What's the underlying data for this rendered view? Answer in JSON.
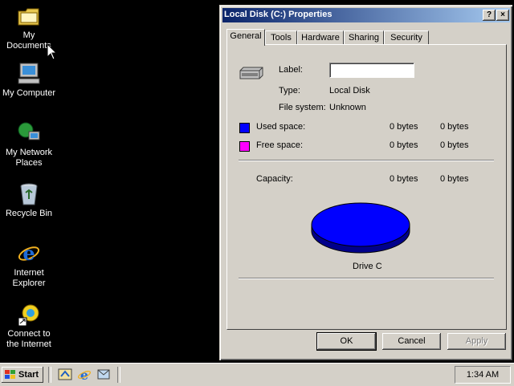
{
  "desktop": {
    "icons": [
      {
        "label_line1": "My Documents",
        "label_line2": ""
      },
      {
        "label_line1": "My Computer",
        "label_line2": ""
      },
      {
        "label_line1": "My Network",
        "label_line2": "Places"
      },
      {
        "label_line1": "Recycle Bin",
        "label_line2": ""
      },
      {
        "label_line1": "Internet",
        "label_line2": "Explorer"
      },
      {
        "label_line1": "Connect to",
        "label_line2": "the Internet"
      }
    ]
  },
  "window": {
    "title": "Local Disk (C:) Properties",
    "help_button": "?",
    "close_button": "×",
    "tabs": [
      "General",
      "Tools",
      "Hardware",
      "Sharing",
      "Security"
    ],
    "active_tab": "General",
    "label_caption": "Label:",
    "label_value": "",
    "type_caption": "Type:",
    "type_value": "Local Disk",
    "fs_caption": "File system:",
    "fs_value": "Unknown",
    "used_caption": "Used space:",
    "used_bytes": "0 bytes",
    "used_size": "0 bytes",
    "free_caption": "Free space:",
    "free_bytes": "0 bytes",
    "free_size": "0 bytes",
    "capacity_caption": "Capacity:",
    "capacity_bytes": "0 bytes",
    "capacity_size": "0 bytes",
    "drive_caption": "Drive C",
    "colors": {
      "used": "#0000ff",
      "free": "#ff00ff",
      "pie": "#0000ff"
    },
    "buttons": {
      "ok": "OK",
      "cancel": "Cancel",
      "apply": "Apply"
    }
  },
  "taskbar": {
    "start_label": "Start",
    "clock": "1:34 AM"
  }
}
